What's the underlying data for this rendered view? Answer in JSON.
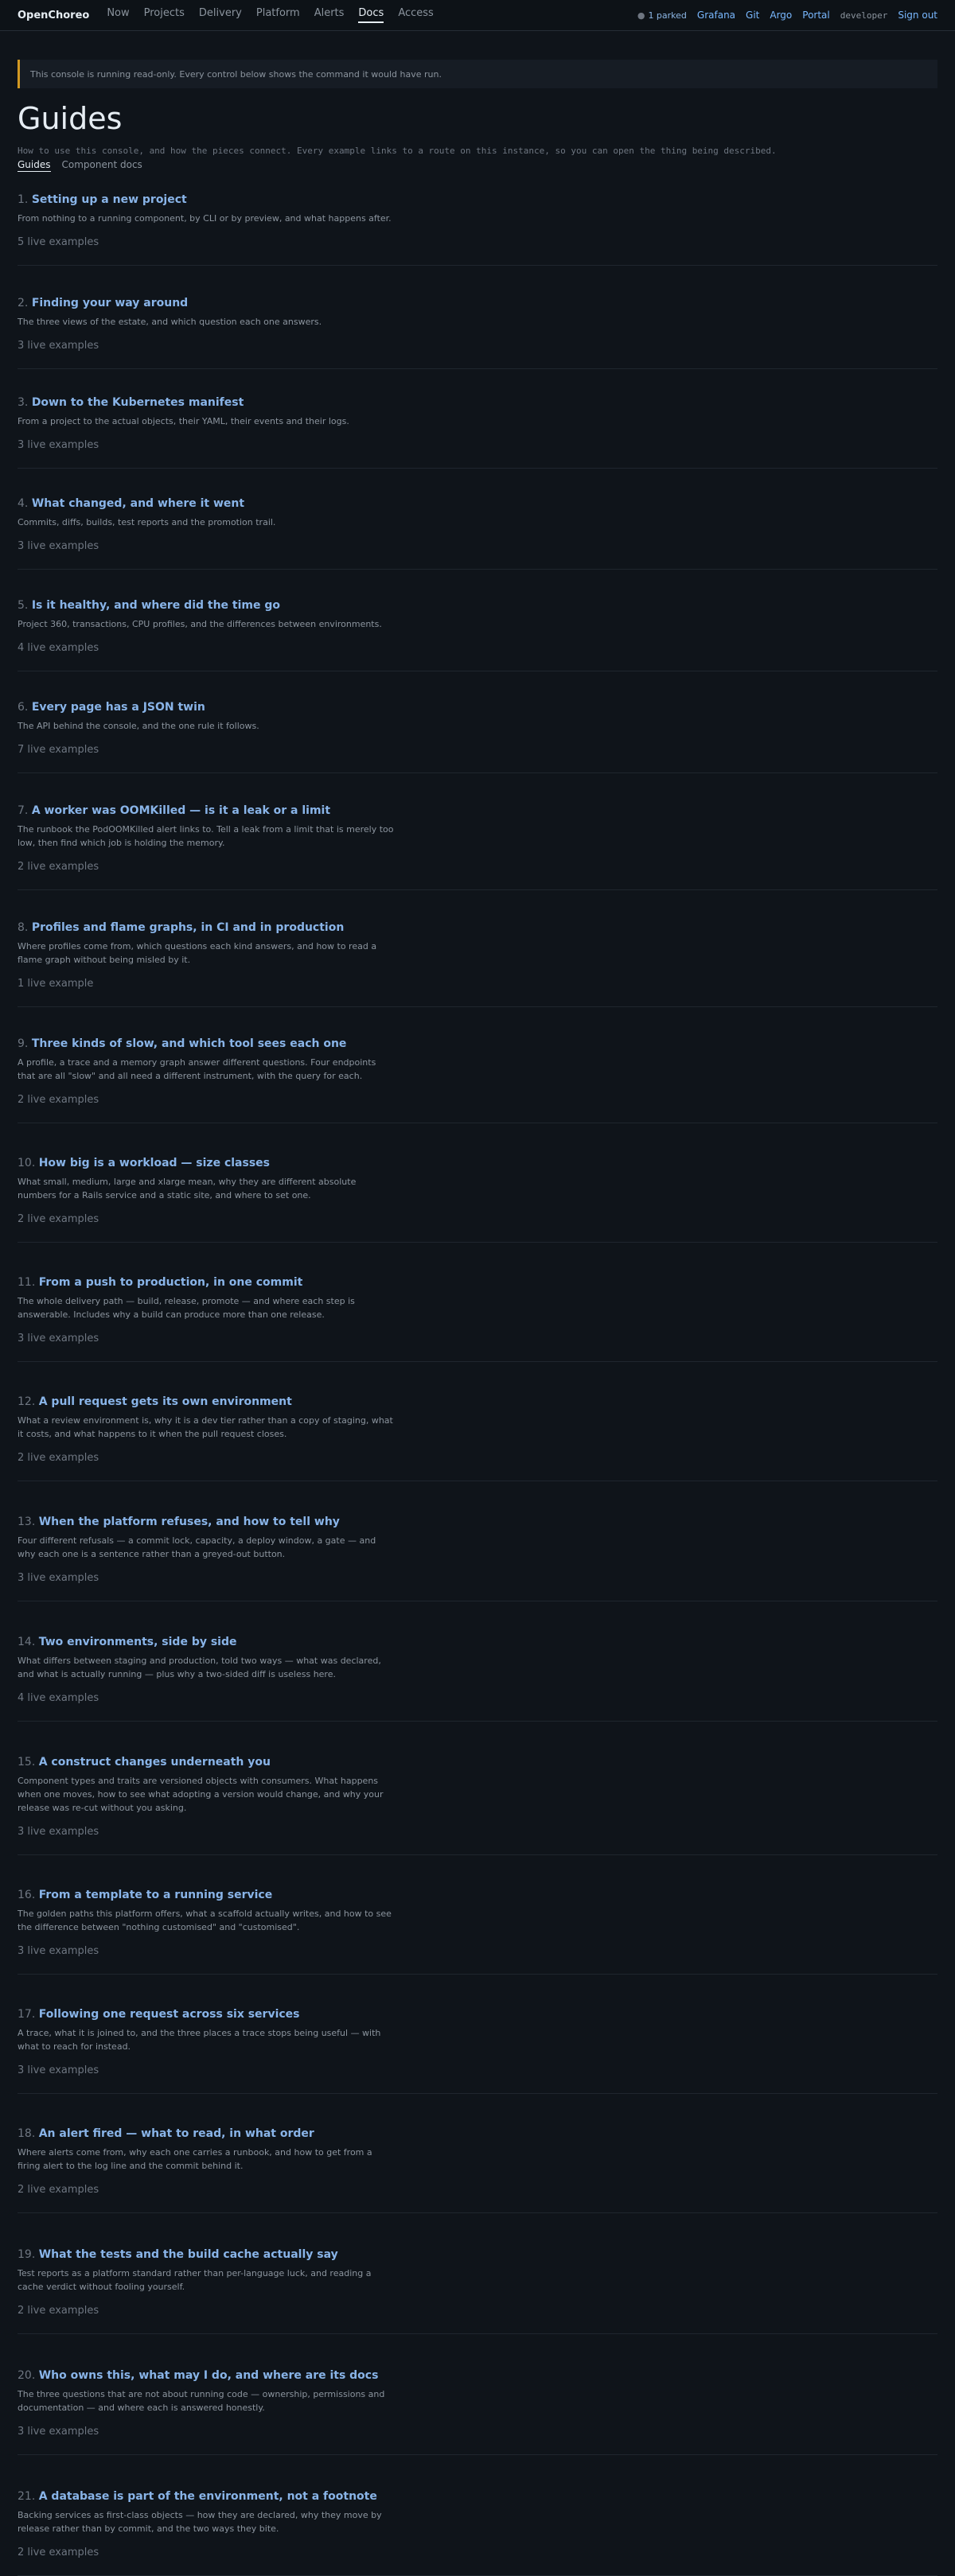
{
  "nav": {
    "brand": "OpenChoreo",
    "items": [
      "Now",
      "Projects",
      "Delivery",
      "Platform",
      "Alerts",
      "Docs",
      "Access"
    ],
    "active": "Docs",
    "parked_icon": "dot-icon",
    "parked": "1 parked",
    "links": [
      "Grafana",
      "Git",
      "Argo",
      "Portal"
    ],
    "user": "developer",
    "signout": "Sign out"
  },
  "notice": "This console is running read-only. Every control below shows the command it would have run.",
  "page": {
    "title": "Guides",
    "subtitle": "How to use this console, and how the pieces connect. Every example links to a route on this instance, so you can open the thing being described.",
    "tabs": [
      "Guides",
      "Component docs"
    ]
  },
  "guides": [
    {
      "num": "1.",
      "title": "Setting up a new project",
      "desc": "From nothing to a running component, by CLI or by preview, and what happens after.",
      "examples": "5 live examples"
    },
    {
      "num": "2.",
      "title": "Finding your way around",
      "desc": "The three views of the estate, and which question each one answers.",
      "examples": "3 live examples"
    },
    {
      "num": "3.",
      "title": "Down to the Kubernetes manifest",
      "desc": "From a project to the actual objects, their YAML, their events and their logs.",
      "examples": "3 live examples"
    },
    {
      "num": "4.",
      "title": "What changed, and where it went",
      "desc": "Commits, diffs, builds, test reports and the promotion trail.",
      "examples": "3 live examples"
    },
    {
      "num": "5.",
      "title": "Is it healthy, and where did the time go",
      "desc": "Project 360, transactions, CPU profiles, and the differences between environments.",
      "examples": "4 live examples"
    },
    {
      "num": "6.",
      "title": "Every page has a JSON twin",
      "desc": "The API behind the console, and the one rule it follows.",
      "examples": "7 live examples"
    },
    {
      "num": "7.",
      "title": "A worker was OOMKilled — is it a leak or a limit",
      "desc": "The runbook the PodOOMKilled alert links to. Tell a leak from a limit that is merely too low, then find which job is holding the memory.",
      "examples": "2 live examples"
    },
    {
      "num": "8.",
      "title": "Profiles and flame graphs, in CI and in production",
      "desc": "Where profiles come from, which questions each kind answers, and how to read a flame graph without being misled by it.",
      "examples": "1 live example"
    },
    {
      "num": "9.",
      "title": "Three kinds of slow, and which tool sees each one",
      "desc": "A profile, a trace and a memory graph answer different questions. Four endpoints that are all \"slow\" and all need a different instrument, with the query for each.",
      "examples": "2 live examples"
    },
    {
      "num": "10.",
      "title": "How big is a workload — size classes",
      "desc": "What small, medium, large and xlarge mean, why they are different absolute numbers for a Rails service and a static site, and where to set one.",
      "examples": "2 live examples"
    },
    {
      "num": "11.",
      "title": "From a push to production, in one commit",
      "desc": "The whole delivery path — build, release, promote — and where each step is answerable. Includes why a build can produce more than one release.",
      "examples": "3 live examples"
    },
    {
      "num": "12.",
      "title": "A pull request gets its own environment",
      "desc": "What a review environment is, why it is a dev tier rather than a copy of staging, what it costs, and what happens to it when the pull request closes.",
      "examples": "2 live examples"
    },
    {
      "num": "13.",
      "title": "When the platform refuses, and how to tell why",
      "desc": "Four different refusals — a commit lock, capacity, a deploy window, a gate — and why each one is a sentence rather than a greyed-out button.",
      "examples": "3 live examples"
    },
    {
      "num": "14.",
      "title": "Two environments, side by side",
      "desc": "What differs between staging and production, told two ways — what was declared, and what is actually running — plus why a two-sided diff is useless here.",
      "examples": "4 live examples"
    },
    {
      "num": "15.",
      "title": "A construct changes underneath you",
      "desc": "Component types and traits are versioned objects with consumers. What happens when one moves, how to see what adopting a version would change, and why your release was re-cut without you asking.",
      "examples": "3 live examples"
    },
    {
      "num": "16.",
      "title": "From a template to a running service",
      "desc": "The golden paths this platform offers, what a scaffold actually writes, and how to see the difference between \"nothing customised\" and \"customised\".",
      "examples": "3 live examples"
    },
    {
      "num": "17.",
      "title": "Following one request across six services",
      "desc": "A trace, what it is joined to, and the three places a trace stops being useful — with what to reach for instead.",
      "examples": "3 live examples"
    },
    {
      "num": "18.",
      "title": "An alert fired — what to read, in what order",
      "desc": "Where alerts come from, why each one carries a runbook, and how to get from a firing alert to the log line and the commit behind it.",
      "examples": "2 live examples"
    },
    {
      "num": "19.",
      "title": "What the tests and the build cache actually say",
      "desc": "Test reports as a platform standard rather than per-language luck, and reading a cache verdict without fooling yourself.",
      "examples": "2 live examples"
    },
    {
      "num": "20.",
      "title": "Who owns this, what may I do, and where are its docs",
      "desc": "The three questions that are not about running code — ownership, permissions and documentation — and where each is answered honestly.",
      "examples": "3 live examples"
    },
    {
      "num": "21.",
      "title": "A database is part of the environment, not a footnote",
      "desc": "Backing services as first-class objects — how they are declared, why they move by release rather than by commit, and the two ways they bite.",
      "examples": "2 live examples"
    }
  ]
}
